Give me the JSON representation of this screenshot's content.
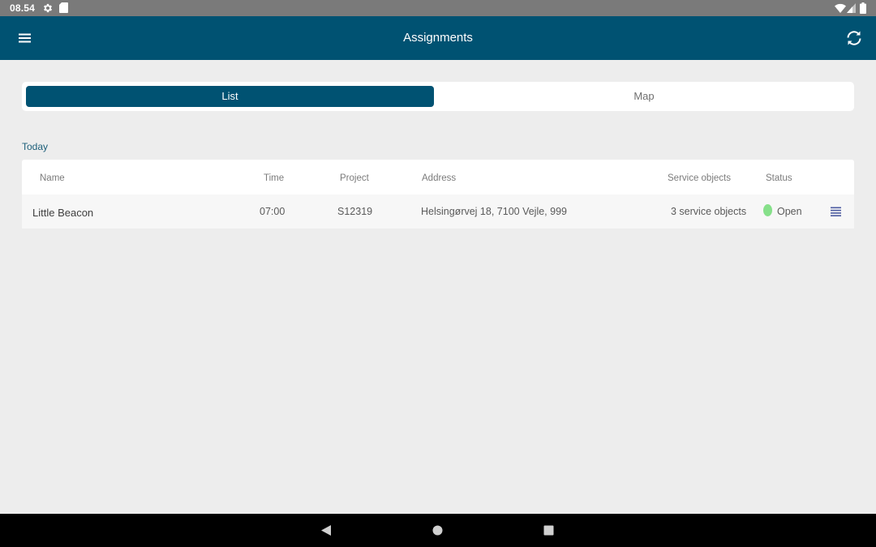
{
  "status_bar": {
    "time": "08.54",
    "icons": [
      "settings-icon",
      "sd-card-icon",
      "wifi-icon",
      "signal-icon",
      "battery-icon"
    ]
  },
  "app_bar": {
    "title": "Assignments",
    "left_icon": "menu-icon",
    "right_icon": "sync-icon",
    "background_color": "#005272"
  },
  "segmented_control": {
    "tabs": [
      {
        "label": "List",
        "selected": true
      },
      {
        "label": "Map",
        "selected": false
      }
    ]
  },
  "section": {
    "label": "Today"
  },
  "table": {
    "columns": [
      "Name",
      "Time",
      "Project",
      "Address",
      "Service objects",
      "Status"
    ],
    "rows": [
      {
        "name": "Little Beacon",
        "time": "07:00",
        "project": "S12319",
        "address": "Helsingørvej 18, 7100 Vejle, 999",
        "service_objects": "3 service objects",
        "status": "Open",
        "status_color": "#86e08a",
        "action_icon": "list-menu-icon"
      }
    ]
  },
  "nav_bar": {
    "icons": [
      "back-icon",
      "home-icon",
      "recents-icon"
    ]
  }
}
